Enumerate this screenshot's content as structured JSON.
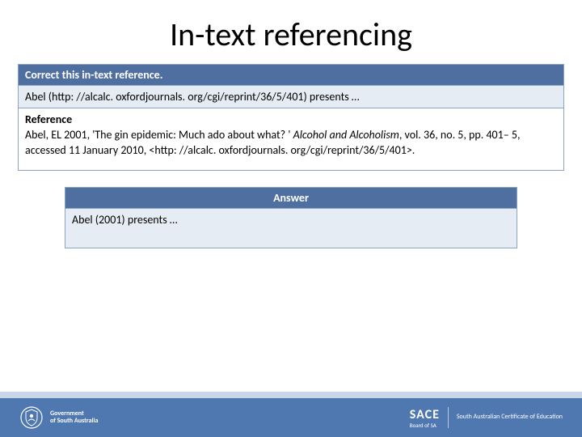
{
  "title": "In-text referencing",
  "panel": {
    "header": "Correct this in-text reference.",
    "example": "Abel (http: //alcalc. oxfordjournals. org/cgi/reprint/36/5/401) presents …",
    "reference_label": "Reference",
    "reference_text_1": "Abel, EL 2001, 'The gin epidemic: Much ado about what? ' ",
    "reference_text_ital": "Alcohol and Alcoholism",
    "reference_text_2": ", vol. 36, no. 5, pp. 401– 5, accessed 11 January 2010, <http: //alcalc. oxfordjournals. org/cgi/reprint/36/5/401>."
  },
  "answer": {
    "header": "Answer",
    "text": "Abel (2001) presents …"
  },
  "footer": {
    "gov_line1": "Government",
    "gov_line2": "of South Australia",
    "sace_logo": "SACE",
    "sace_sub": "Board of SA",
    "sace_right": "South Australian Certificate of Education"
  }
}
